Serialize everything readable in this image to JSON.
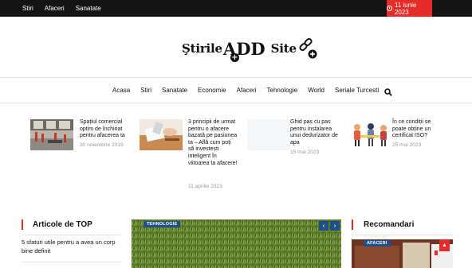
{
  "topbar": {
    "links": [
      "Stiri",
      "Afaceri",
      "Sanatate"
    ],
    "date": "11 iunie 2023"
  },
  "logo": {
    "part1": "Ştirile",
    "part2": "ADD",
    "part3": "Site",
    "plus": "+"
  },
  "mainnav": {
    "items": [
      "Acasa",
      "Stiri",
      "Sanatate",
      "Economie",
      "Afaceri",
      "Tehnologie",
      "World",
      "Seriale Turcesti"
    ]
  },
  "featured": [
    {
      "title": "Spațiul comercial optim de închiriat pentru afacerea ta",
      "date": "30 noiembrie 2019"
    },
    {
      "title": "3 principii de urmat pentru o afacere bazată pe pasiunea ta – Află cum poți să investești inteligent în viitoarea ta afacere!",
      "date": "11 aprilie 2023"
    },
    {
      "title": "Ghid pas cu pas pentru instalarea unui dedurizator de apa",
      "date": "15 mai 2023"
    },
    {
      "title": "În ce condiții se poate obține un certificat ISO?",
      "date": "25 mai 2023"
    }
  ],
  "sections": {
    "top": {
      "title": "Articole de TOP",
      "first_article": "5 sfaturi utile pentru a avea un corp bine definit"
    },
    "slider": {
      "tag": "TEHNOLOGIE",
      "prev": "‹",
      "next": "›"
    },
    "recommended": {
      "title": "Recomandari",
      "tag": "AFACERI"
    }
  },
  "icons": {
    "search": "search-icon",
    "clock": "clock-icon",
    "to_top": "▲"
  },
  "colors": {
    "accent": "#e62b2b",
    "tag_blue": "#1e4f87",
    "topbar": "#141414"
  }
}
